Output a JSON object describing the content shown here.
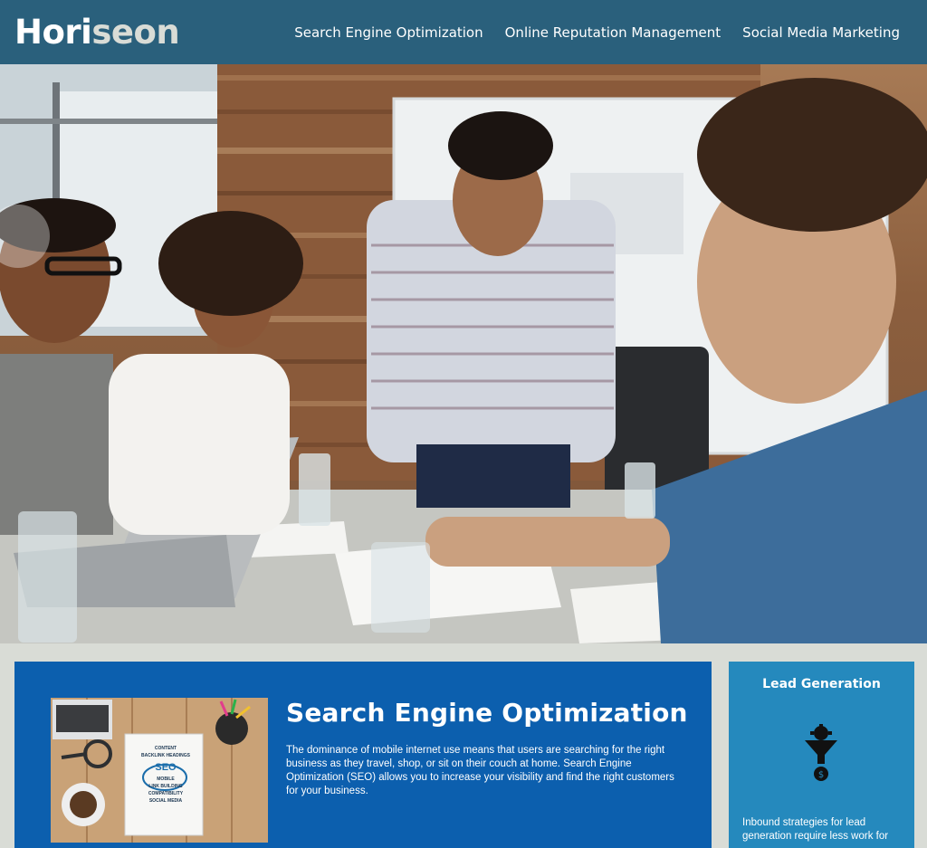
{
  "header": {
    "logo_primary": "Hori",
    "logo_accent": "seon",
    "nav": [
      {
        "label": "Search Engine Optimization"
      },
      {
        "label": "Online Reputation Management"
      },
      {
        "label": "Social Media Marketing"
      }
    ]
  },
  "seo_card": {
    "title": "Search Engine Optimization",
    "body": "The dominance of mobile internet use means that users are searching for the right business as they travel, shop, or sit on their couch at home. Search Engine Optimization (SEO) allows you to increase your visibility and find the right customers for your business.",
    "image_words": [
      "CONTENT",
      "BACKLINK",
      "HEADINGS",
      "SEO",
      "MOBILE",
      "LINK BUILDING",
      "COMPATIBILITY",
      "SOCIAL MEDIA"
    ]
  },
  "sidebar": {
    "title": "Lead Generation",
    "icon": "lead-funnel-icon",
    "body": "Inbound strategies for lead generation require less work for"
  },
  "colors": {
    "header_bg": "#2a607c",
    "card_bg": "#0c5fae",
    "side_bg": "#2589bd",
    "page_bg": "#d9dcd6"
  }
}
